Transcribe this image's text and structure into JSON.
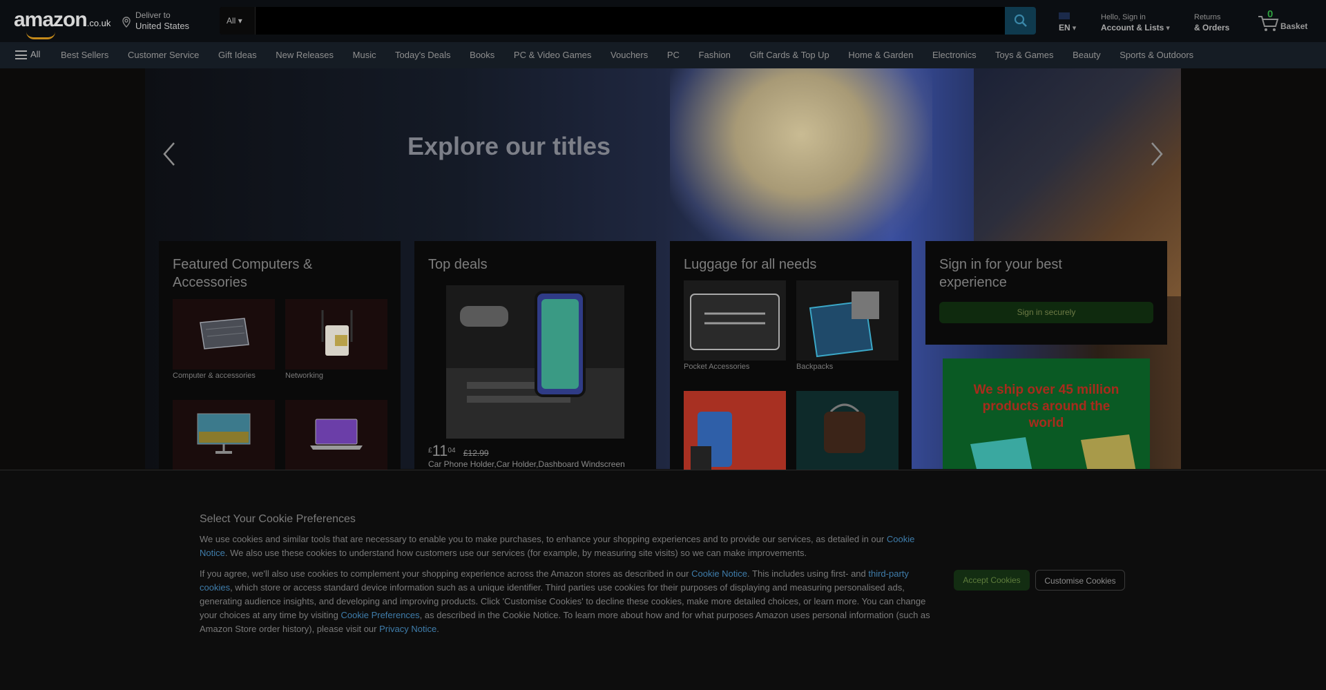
{
  "header": {
    "logo_text": "amazon",
    "logo_domain": ".co.uk",
    "deliver_line1": "Deliver to",
    "deliver_line2": "United States",
    "search": {
      "category": "All",
      "placeholder": ""
    },
    "language": "EN",
    "account_line1": "Hello, Sign in",
    "account_line2": "Account & Lists",
    "returns_line1": "Returns",
    "returns_line2": "& Orders",
    "basket_count": "0",
    "basket_label": "Basket"
  },
  "nav": {
    "all_label": "All",
    "links": [
      "Best Sellers",
      "Customer Service",
      "Gift Ideas",
      "New Releases",
      "Music",
      "Today's Deals",
      "Books",
      "PC & Video Games",
      "Vouchers",
      "PC",
      "Fashion",
      "Gift Cards & Top Up",
      "Home & Garden",
      "Electronics",
      "Toys & Games",
      "Beauty",
      "Sports & Outdoors"
    ]
  },
  "hero": {
    "headline": "Explore our titles"
  },
  "cards": {
    "computers": {
      "title": "Featured Computers & Accessories",
      "tiles": [
        {
          "label": "Computer & accessories",
          "icon": "keyboard-icon"
        },
        {
          "label": "Networking",
          "icon": "router-icon"
        },
        {
          "label": "",
          "icon": "monitor-icon"
        },
        {
          "label": "",
          "icon": "laptop-icon"
        }
      ]
    },
    "deals": {
      "title": "Top deals",
      "price_whole": "11",
      "price_fraction": "04",
      "price_currency": "£",
      "price_was": "£12.99",
      "product": "Car Phone Holder,Car Holder,Dashboard Windscreen"
    },
    "luggage": {
      "title": "Luggage for all needs",
      "tiles": [
        {
          "label": "Pocket Accessories"
        },
        {
          "label": "Backpacks"
        },
        {
          "label": ""
        },
        {
          "label": ""
        }
      ]
    },
    "signin": {
      "title": "Sign in for your best experience",
      "button": "Sign in securely"
    },
    "promo": {
      "text": "We ship over 45 million products around the world"
    }
  },
  "cookie": {
    "title": "Select Your Cookie Preferences",
    "p1_a": "We use cookies and similar tools that are necessary to enable you to make purchases, to enhance your shopping experiences and to provide our services, as detailed in our ",
    "p1_link": "Cookie Notice",
    "p1_b": ". We also use these cookies to understand how customers use our services (for example, by measuring site visits) so we can make improvements.",
    "p2_a": "If you agree, we'll also use cookies to complement your shopping experience across the Amazon stores as described in our ",
    "p2_link1": "Cookie Notice",
    "p2_b": ". This includes using first- and ",
    "p2_link2": "third-party cookies",
    "p2_c": ", which store or access standard device information such as a unique identifier. Third parties use cookies for their purposes of displaying and measuring personalised ads, generating audience insights, and developing and improving products. Click 'Customise Cookies' to decline these cookies, make more detailed choices, or learn more. You can change your choices at any time by visiting ",
    "p2_link3": "Cookie Preferences",
    "p2_d": ", as described in the Cookie Notice. To learn more about how and for what purposes Amazon uses personal information (such as Amazon Store order history), please visit our ",
    "p2_link4": "Privacy Notice",
    "p2_e": ".",
    "accept": "Accept Cookies",
    "customise": "Customise Cookies"
  }
}
